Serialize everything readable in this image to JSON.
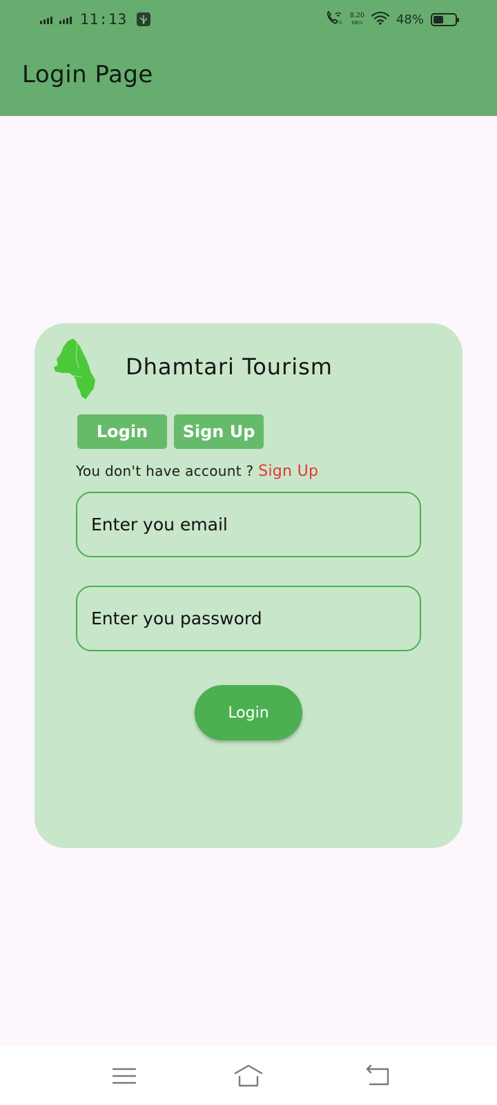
{
  "status_bar": {
    "time": "11:13",
    "net_speed_value": "8.20",
    "net_speed_unit": "KB/s",
    "battery_percent": "48%",
    "battery_level": 0.48,
    "icons": [
      "signal-1-icon",
      "signal-2-icon",
      "usb-icon",
      "wifi-call-icon",
      "wifi-icon",
      "battery-icon"
    ]
  },
  "app_bar": {
    "title": "Login Page"
  },
  "card": {
    "brand": "Dhamtari Tourism",
    "logo_icon": "district-map-logo",
    "tabs": {
      "login": "Login",
      "signup": "Sign Up"
    },
    "account_prompt": "You don't have account ?",
    "account_link": "Sign Up",
    "email": {
      "placeholder": "Enter you email",
      "value": ""
    },
    "password": {
      "placeholder": "Enter you password",
      "value": ""
    },
    "submit": "Login"
  },
  "nav_bar": {
    "icons": [
      "menu-icon",
      "home-icon",
      "back-icon"
    ]
  },
  "colors": {
    "app_bar": "#67ad70",
    "background": "#fdf6fd",
    "card": "#c8e6c9",
    "tab_button": "#66bb6a",
    "primary_button": "#4caf50",
    "link": "#e53935"
  }
}
